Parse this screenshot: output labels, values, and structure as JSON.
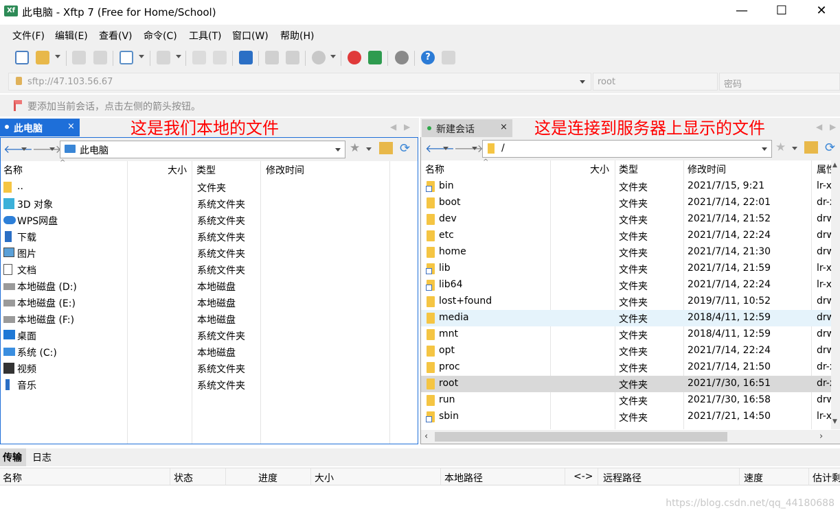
{
  "window": {
    "title": "此电脑 - Xftp 7 (Free for Home/School)",
    "icon_label": "Xf"
  },
  "menu": [
    "文件(F)",
    "编辑(E)",
    "查看(V)",
    "命令(C)",
    "工具(T)",
    "窗口(W)",
    "帮助(H)"
  ],
  "address": {
    "url": "sftp://47.103.56.67",
    "user": "root",
    "password_placeholder": "密码"
  },
  "hint": "要添加当前会话，点击左侧的箭头按钮。",
  "left_pane": {
    "tab_label": "此电脑",
    "tab_close": "×",
    "annotation": "这是我们本地的文件",
    "path": "此电脑",
    "columns": [
      "名称",
      "大小",
      "类型",
      "修改时间"
    ],
    "rows": [
      {
        "name": "..",
        "size": "",
        "type": "文件夹",
        "icon": "folder-icon"
      },
      {
        "name": "3D 对象",
        "size": "",
        "type": "系统文件夹",
        "icon": "3d-objects-icon"
      },
      {
        "name": "WPS网盘",
        "size": "",
        "type": "系统文件夹",
        "icon": "cloud-icon"
      },
      {
        "name": "下载",
        "size": "",
        "type": "系统文件夹",
        "icon": "download-icon"
      },
      {
        "name": "图片",
        "size": "",
        "type": "系统文件夹",
        "icon": "pictures-icon"
      },
      {
        "name": "文档",
        "size": "",
        "type": "系统文件夹",
        "icon": "document-icon"
      },
      {
        "name": "本地磁盘 (D:)",
        "size": "",
        "type": "本地磁盘",
        "icon": "drive-icon"
      },
      {
        "name": "本地磁盘 (E:)",
        "size": "",
        "type": "本地磁盘",
        "icon": "drive-icon"
      },
      {
        "name": "本地磁盘 (F:)",
        "size": "",
        "type": "本地磁盘",
        "icon": "drive-icon"
      },
      {
        "name": "桌面",
        "size": "",
        "type": "系统文件夹",
        "icon": "desktop-icon"
      },
      {
        "name": "系统 (C:)",
        "size": "",
        "type": "本地磁盘",
        "icon": "system-drive-icon"
      },
      {
        "name": "视频",
        "size": "",
        "type": "系统文件夹",
        "icon": "video-icon"
      },
      {
        "name": "音乐",
        "size": "",
        "type": "系统文件夹",
        "icon": "music-icon"
      }
    ]
  },
  "right_pane": {
    "tab_label": "新建会话",
    "tab_close": "×",
    "annotation": "这是连接到服务器上显示的文件",
    "path": "/",
    "columns": [
      "名称",
      "大小",
      "类型",
      "修改时间",
      "属性"
    ],
    "rows": [
      {
        "name": "bin",
        "type": "文件夹",
        "modified": "2021/7/15, 9:21",
        "attr": "lr-x",
        "link": true
      },
      {
        "name": "boot",
        "type": "文件夹",
        "modified": "2021/7/14, 22:01",
        "attr": "dr-x",
        "link": false
      },
      {
        "name": "dev",
        "type": "文件夹",
        "modified": "2021/7/14, 21:52",
        "attr": "drw",
        "link": false
      },
      {
        "name": "etc",
        "type": "文件夹",
        "modified": "2021/7/14, 22:24",
        "attr": "drw",
        "link": false
      },
      {
        "name": "home",
        "type": "文件夹",
        "modified": "2021/7/14, 21:30",
        "attr": "drw",
        "link": false
      },
      {
        "name": "lib",
        "type": "文件夹",
        "modified": "2021/7/14, 21:59",
        "attr": "lr-x",
        "link": true
      },
      {
        "name": "lib64",
        "type": "文件夹",
        "modified": "2021/7/14, 22:24",
        "attr": "lr-x",
        "link": true
      },
      {
        "name": "lost+found",
        "type": "文件夹",
        "modified": "2019/7/11, 10:52",
        "attr": "drw",
        "link": false
      },
      {
        "name": "media",
        "type": "文件夹",
        "modified": "2018/4/11, 12:59",
        "attr": "drw",
        "link": false,
        "state": "hover"
      },
      {
        "name": "mnt",
        "type": "文件夹",
        "modified": "2018/4/11, 12:59",
        "attr": "drw",
        "link": false
      },
      {
        "name": "opt",
        "type": "文件夹",
        "modified": "2021/7/14, 22:24",
        "attr": "drw",
        "link": false
      },
      {
        "name": "proc",
        "type": "文件夹",
        "modified": "2021/7/14, 21:50",
        "attr": "dr-x",
        "link": false
      },
      {
        "name": "root",
        "type": "文件夹",
        "modified": "2021/7/30, 16:51",
        "attr": "dr-x",
        "link": false,
        "state": "selected"
      },
      {
        "name": "run",
        "type": "文件夹",
        "modified": "2021/7/30, 16:58",
        "attr": "drw",
        "link": false
      },
      {
        "name": "sbin",
        "type": "文件夹",
        "modified": "2021/7/21, 14:50",
        "attr": "lr-x",
        "link": true
      }
    ]
  },
  "bottom": {
    "tabs": [
      "传输",
      "日志"
    ],
    "columns": [
      "名称",
      "状态",
      "进度",
      "大小",
      "本地路径",
      "<->",
      "远程路径",
      "速度",
      "估计剩"
    ]
  },
  "watermark": "https://blog.csdn.net/qq_44180688",
  "colors": {
    "accent": "#1e6fd9",
    "annotation": "#ff0000",
    "folder": "#f5c543"
  }
}
